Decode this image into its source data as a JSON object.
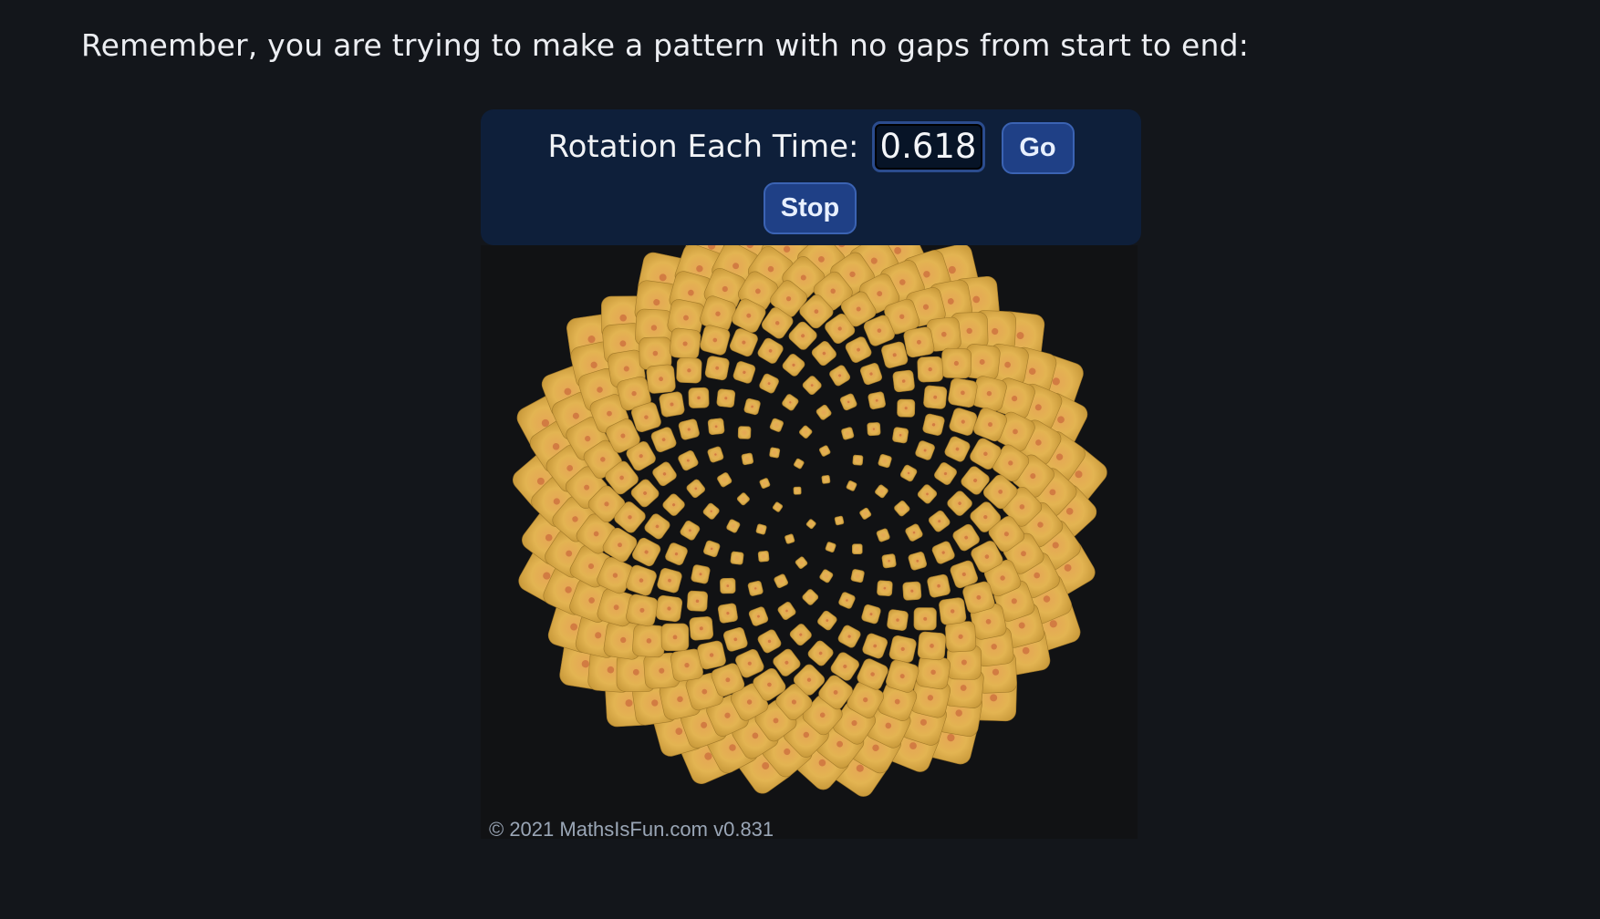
{
  "intro_text": "Remember, you are trying to make a pattern with no gaps from start to end:",
  "controls": {
    "rotation_label": "Rotation Each Time:",
    "rotation_value": "0.618",
    "go_label": "Go",
    "stop_label": "Stop"
  },
  "simulation": {
    "rotation_per_seed": 0.618,
    "seed_shape": "rounded-square-seed",
    "seed_color": "#e2b44e",
    "seed_center_color": "#c96a3a",
    "background_color": "#111214"
  },
  "footer": {
    "copyright": "© 2021 MathsIsFun.com v0.831"
  },
  "colors": {
    "page_background": "#13161b",
    "panel_background": "#0e1f3a",
    "button_background": "#1f4086",
    "button_border": "#3b63b3"
  }
}
